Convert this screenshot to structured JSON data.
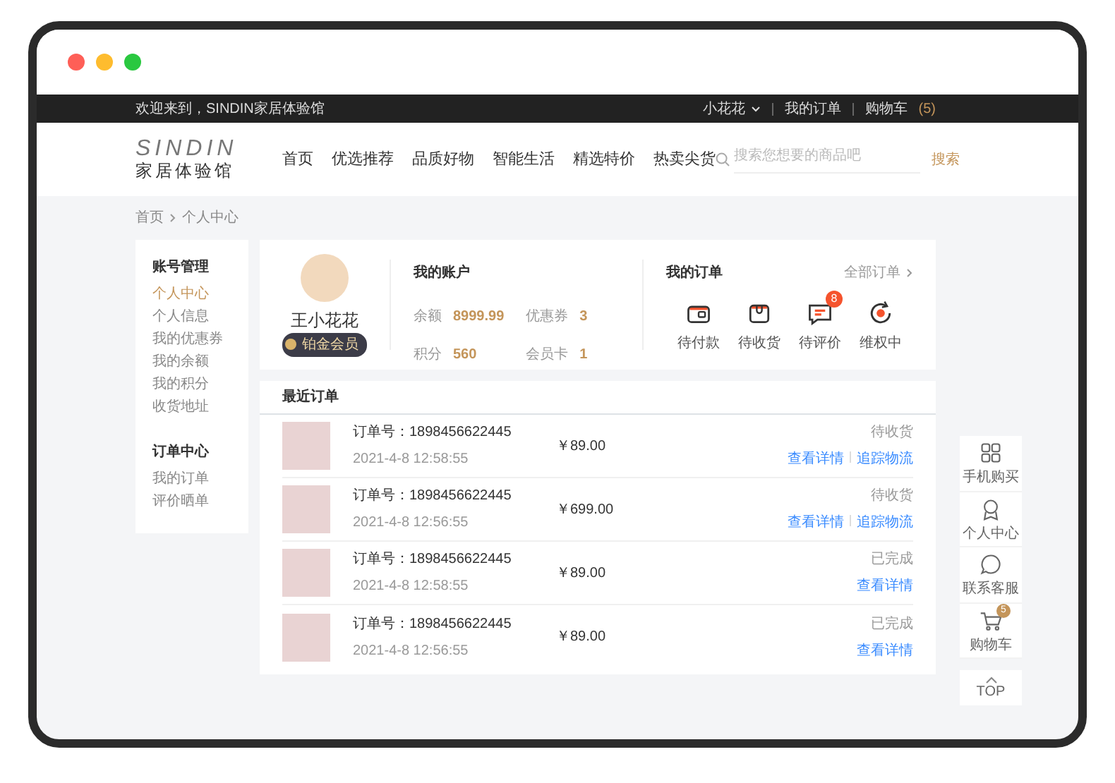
{
  "top_bar": {
    "welcome": "欢迎来到，SINDIN家居体验馆",
    "user": "小花花",
    "links": [
      {
        "label": "我的订单"
      },
      {
        "label": "购物车",
        "count": "(5)"
      }
    ]
  },
  "header": {
    "logo_mark": "SINDIN",
    "logo_text": "家居体验馆",
    "nav": [
      "首页",
      "优选推荐",
      "品质好物",
      "智能生活",
      "精选特价",
      "热卖尖货"
    ],
    "search": {
      "placeholder": "搜索您想要的商品吧",
      "button": "搜索"
    }
  },
  "breadcrumb": [
    "首页",
    "个人中心"
  ],
  "sidebar": {
    "groups": [
      {
        "title": "账号管理",
        "items": [
          {
            "label": "个人中心",
            "selected": true
          },
          {
            "label": "个人信息",
            "selected": false
          },
          {
            "label": "我的优惠券",
            "selected": false
          },
          {
            "label": "我的余额",
            "selected": false
          },
          {
            "label": "我的积分",
            "selected": false
          },
          {
            "label": "收货地址",
            "selected": false
          }
        ]
      },
      {
        "title": "订单中心",
        "items": [
          {
            "label": "我的订单",
            "selected": false
          },
          {
            "label": "评价晒单",
            "selected": false
          }
        ]
      }
    ]
  },
  "profile": {
    "name": "王小花花",
    "badge": "铂金会员"
  },
  "account": {
    "title": "我的账户",
    "stats": [
      {
        "label": "余额",
        "value": "8999.99"
      },
      {
        "label": "优惠券",
        "value": "3"
      },
      {
        "label": "积分",
        "value": "560"
      },
      {
        "label": "会员卡",
        "value": "1"
      }
    ]
  },
  "orders_summary": {
    "title": "我的订单",
    "all_link": "全部订单",
    "items": [
      {
        "kind": "pay",
        "label": "待付款"
      },
      {
        "kind": "receive",
        "label": "待收货"
      },
      {
        "kind": "review",
        "label": "待评价",
        "badge": "8"
      },
      {
        "kind": "refund",
        "label": "维权中"
      }
    ]
  },
  "recent_orders": {
    "title": "最近订单",
    "rows": [
      {
        "order_no": "订单号：1898456622445",
        "time": "2021-4-8 12:58:55",
        "price": "￥89.00",
        "status": "待收货",
        "actions": [
          "查看详情",
          "追踪物流"
        ]
      },
      {
        "order_no": "订单号：1898456622445",
        "time": "2021-4-8 12:56:55",
        "price": "￥699.00",
        "status": "待收货",
        "actions": [
          "查看详情",
          "追踪物流"
        ]
      },
      {
        "order_no": "订单号：1898456622445",
        "time": "2021-4-8 12:58:55",
        "price": "￥89.00",
        "status": "已完成",
        "actions": [
          "查看详情"
        ]
      },
      {
        "order_no": "订单号：1898456622445",
        "time": "2021-4-8 12:56:55",
        "price": "￥89.00",
        "status": "已完成",
        "actions": [
          "查看详情"
        ]
      }
    ]
  },
  "side_toolbar": {
    "items": [
      {
        "kind": "phone",
        "label": "手机购买"
      },
      {
        "kind": "user",
        "label": "个人中心"
      },
      {
        "kind": "chat",
        "label": "联系客服"
      },
      {
        "kind": "cart",
        "label": "购物车",
        "badge": "5"
      }
    ],
    "top": "TOP"
  }
}
